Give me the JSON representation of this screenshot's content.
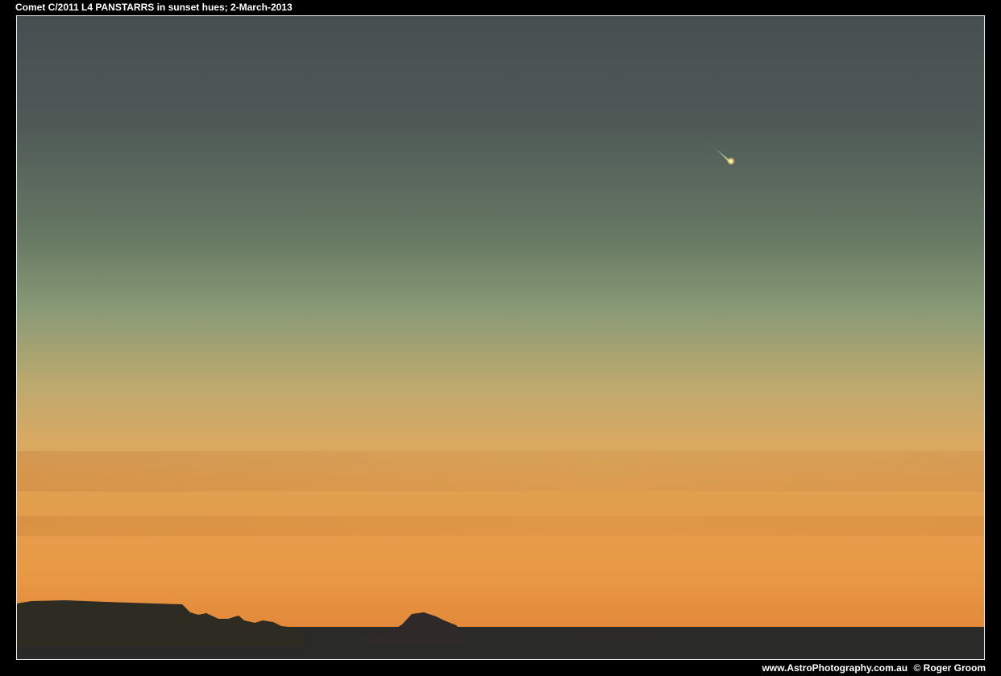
{
  "caption": "Comet C/2011 L4 PANSTARRS in sunset hues; 2-March-2013",
  "credit": {
    "website": "www.AstroPhotography.com.au",
    "copyright": "© Roger Groom"
  },
  "colors": {
    "background": "#000000",
    "frame_border": "#e8e8e8",
    "sky_top": "#464f50",
    "sky_middle": "#7e8e73",
    "sky_lower": "#c2a86c",
    "sky_horizon": "#e89040",
    "sea": "#2a2a29",
    "land": "#2e2b22",
    "comet_nucleus": "#fff3b0"
  }
}
